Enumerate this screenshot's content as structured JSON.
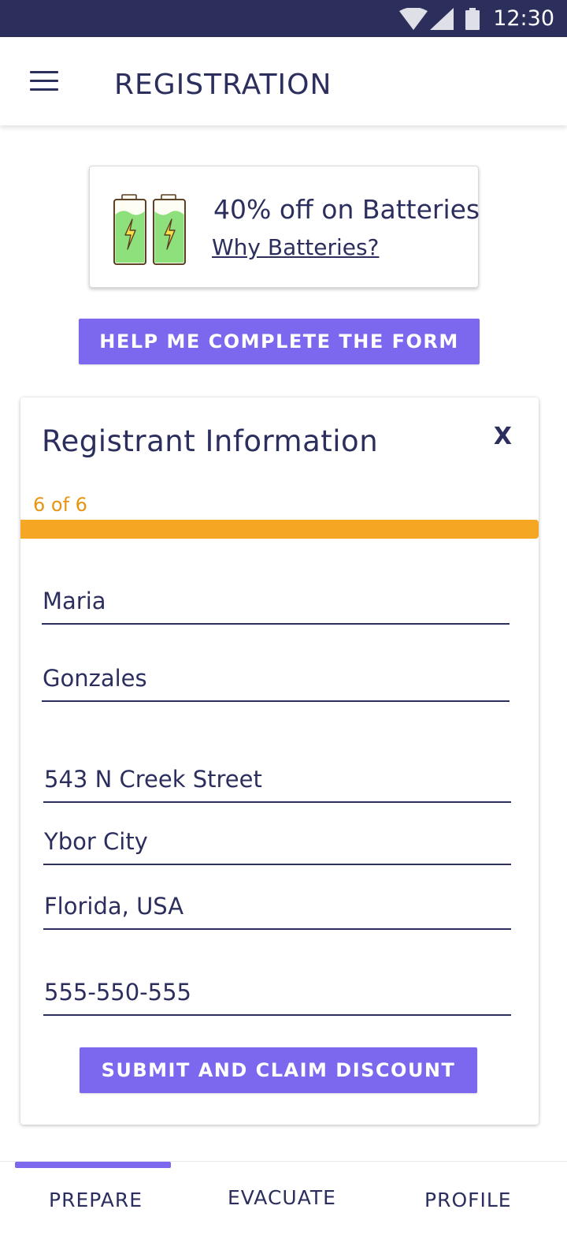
{
  "status_bar": {
    "time": "12:30",
    "icons": [
      "wifi-icon",
      "signal-icon",
      "battery-icon"
    ]
  },
  "app_bar": {
    "title": "REGISTRATION",
    "menu_icon": "hamburger-menu-icon"
  },
  "promo": {
    "headline": "40% off on Batteries",
    "link": "Why Batteries?",
    "icon": "batteries-icon"
  },
  "help_button": "HELP ME COMPLETE THE FORM",
  "form": {
    "title": "Registrant Information",
    "close": "X",
    "step_text": "6 of 6",
    "progress": 1.0,
    "fields": {
      "first_name": "Maria",
      "last_name": "Gonzales",
      "street": "543 N Creek Street",
      "city": "Ybor City",
      "state_country": "Florida, USA",
      "phone": "555-550-555"
    },
    "submit": "SUBMIT AND CLAIM DISCOUNT"
  },
  "bottom_nav": {
    "tabs": [
      {
        "label": "PREPARE",
        "active": true
      },
      {
        "label": "EVACUATE",
        "active": false
      },
      {
        "label": "PROFILE",
        "active": false
      }
    ]
  },
  "colors": {
    "primary_dark": "#2c2f5c",
    "accent": "#7b68ee",
    "progress": "#f5a623",
    "step_text": "#e69510"
  }
}
